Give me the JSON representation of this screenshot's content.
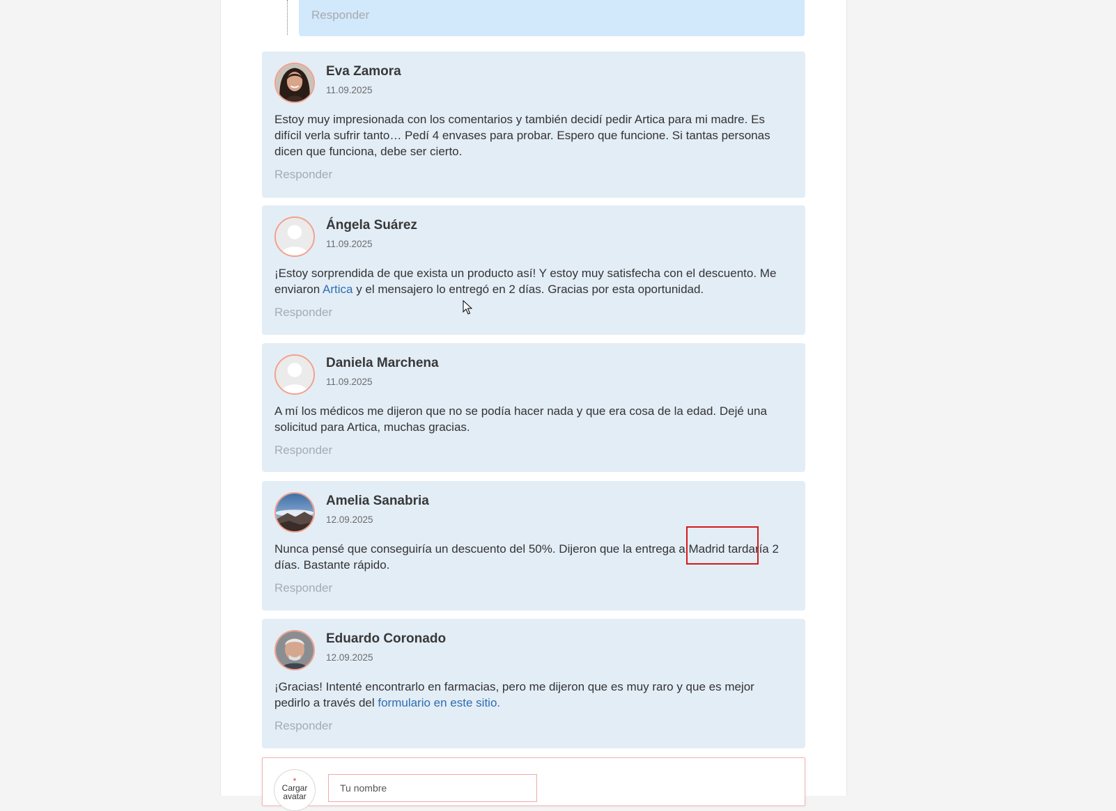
{
  "nested_reply": {
    "reply_label": "Responder"
  },
  "comments": [
    {
      "name": "Eva Zamora",
      "date": "11.09.2025",
      "avatar": "woman-photo",
      "text_before": "Estoy muy impresionada con los comentarios y también decidí pedir Artica para mi madre. Es difícil verla sufrir tanto… Pedí 4 envases para probar. Espero que funcione. Si tantas personas dicen que funciona, debe ser cierto.",
      "link": "",
      "text_after": "",
      "reply_label": "Responder"
    },
    {
      "name": "Ángela Suárez",
      "date": "11.09.2025",
      "avatar": "default-user",
      "text_before": "¡Estoy sorprendida de que exista un producto así! Y estoy muy satisfecha con el descuento. Me enviaron ",
      "link": "Artica",
      "text_after": " y el mensajero lo entregó en 2 días. Gracias por esta oportunidad.",
      "reply_label": "Responder"
    },
    {
      "name": "Daniela Marchena",
      "date": "11.09.2025",
      "avatar": "default-user",
      "text_before": "A mí los médicos me dijeron que no se podía hacer nada y que era cosa de la edad. Dejé una solicitud para Artica, muchas gracias.",
      "link": "",
      "text_after": "",
      "reply_label": "Responder"
    },
    {
      "name": "Amelia Sanabria",
      "date": "12.09.2025",
      "avatar": "mountain-landscape",
      "text_before": "Nunca pensé que conseguiría un descuento del 50%. Dijeron que la entrega a Madrid tardaría 2 días. Bastante rápido.",
      "link": "",
      "text_after": "",
      "reply_label": "Responder"
    },
    {
      "name": "Eduardo Coronado",
      "date": "12.09.2025",
      "avatar": "older-man-photo",
      "text_before": "¡Gracias! Intenté encontrarlo en farmacias, pero me dijeron que es muy raro y que es mejor pedirlo a través del ",
      "link": "formulario en este sitio.",
      "text_after": "",
      "reply_label": "Responder"
    }
  ],
  "form": {
    "upload_required_mark": "*",
    "upload_label": "Cargar avatar",
    "name_placeholder": "Tu nombre",
    "name_value": ""
  },
  "colors": {
    "comment_bg": "#e3edf6",
    "nested_bg": "#d2e8fb",
    "link": "#2d6db2",
    "avatar_border": "#f3a08a",
    "highlight": "#d51a1a"
  },
  "icons": {
    "cursor": "mouse-pointer-icon"
  }
}
